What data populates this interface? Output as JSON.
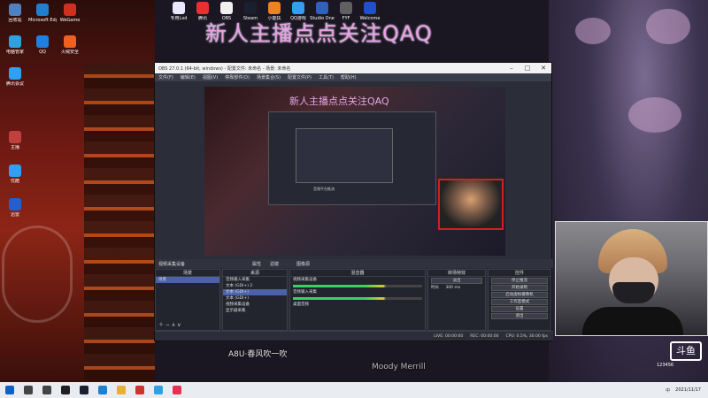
{
  "banner": "新人主播点点关注QAQ",
  "desktop_icons_top": [
    {
      "label": "专用Lxd",
      "color": "#e8e8ff"
    },
    {
      "label": "腾讯",
      "color": "#e83030"
    },
    {
      "label": "OBS",
      "color": "#f0f0f0"
    },
    {
      "label": "Steam",
      "color": "#1a2030"
    },
    {
      "label": "小能扶",
      "color": "#f08020"
    },
    {
      "label": "QQ游戏",
      "color": "#30a0f0"
    },
    {
      "label": "Studio One",
      "color": "#3060c0"
    },
    {
      "label": "FYF",
      "color": "#606060"
    },
    {
      "label": "Welcome",
      "color": "#2050d0"
    }
  ],
  "desktop_icons_left": [
    {
      "label": "回收站",
      "color": "#5080c0"
    },
    {
      "label": "Microsoft Edge",
      "color": "#2080d0"
    },
    {
      "label": "WeGame",
      "color": "#d03020"
    },
    {
      "label": "电脑管家",
      "color": "#30a0e0"
    },
    {
      "label": "QQ",
      "color": "#2080e0"
    },
    {
      "label": "火绒安全",
      "color": "#f06020"
    },
    {
      "label": "腾讯会议",
      "color": "#30a0f0"
    },
    {
      "label": "主播",
      "color": "#c04040"
    },
    {
      "label": "优酷",
      "color": "#30a0f0"
    },
    {
      "label": "迅雷",
      "color": "#2060d0"
    }
  ],
  "obs": {
    "title": "OBS 27.0.1 (64-bit, windows) - 配置文件: 未命名 - 场景: 未命名",
    "menus": [
      "文件(F)",
      "编辑(E)",
      "视图(V)",
      "停靠部件(D)",
      "场景集合(S)",
      "配置文件(P)",
      "工具(T)",
      "帮助(H)"
    ],
    "preview_banner": "新人主播点点关注QAQ",
    "nested_label": "音频平台推流",
    "control_row": [
      "视频采集设备",
      "属性",
      "滤镜",
      "图像源"
    ],
    "scenes_header": "场景",
    "scenes": [
      "场景"
    ],
    "sources_header": "来源",
    "sources": [
      "音频输入采集",
      "文本 (GDI+) 2",
      "文本 (GDI+)",
      "文本 (GDI+)",
      "视频采集设备",
      "显示器采集"
    ],
    "mixer_header": "混音器",
    "mixer": [
      "视频采集设备",
      "音频输入采集",
      "桌面音频"
    ],
    "transition_header": "转场特效",
    "transition_value": "淡出",
    "duration_label": "时长",
    "duration_value": "300 ms",
    "controls_header": "控件",
    "controls": [
      "停止推流",
      "开始录制",
      "启动虚拟摄像机",
      "工作室模式",
      "设置",
      "退出"
    ],
    "status": [
      "LIVE: 00:00:00",
      "REC: 00:00:00",
      "CPU: 0.5%, 30.00 fps"
    ]
  },
  "subtitle_line1": "A8U·春风吹一吹",
  "subtitle_line2": "Moody Merrill",
  "platform_logo": "斗鱼",
  "watermark": "123456",
  "taskbar_icons": [
    {
      "name": "start",
      "color": "#1060c0"
    },
    {
      "name": "search",
      "color": "#444"
    },
    {
      "name": "task-view",
      "color": "#444"
    },
    {
      "name": "obs",
      "color": "#202020"
    },
    {
      "name": "steam",
      "color": "#1a2030"
    },
    {
      "name": "edge",
      "color": "#2080d0"
    },
    {
      "name": "folder",
      "color": "#e8b030"
    },
    {
      "name": "music",
      "color": "#d03030"
    },
    {
      "name": "chat",
      "color": "#30a0e0"
    },
    {
      "name": "app",
      "color": "#e83050"
    }
  ],
  "tray": {
    "ime": "中",
    "time": "2021/11/17"
  }
}
